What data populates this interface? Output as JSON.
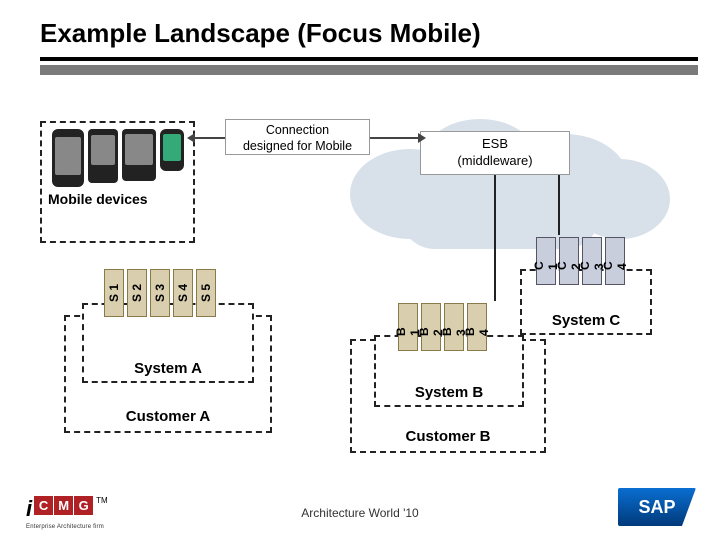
{
  "title": "Example Landscape (Focus Mobile)",
  "mobile_devices_label": "Mobile devices",
  "connection_label_line1": "Connection",
  "connection_label_line2": "designed for Mobile",
  "esb_line1": "ESB",
  "esb_line2": "(middleware)",
  "system_a": {
    "label": "System A",
    "services": [
      "S 1",
      "S 2",
      "S 3",
      "S 4",
      "S 5"
    ]
  },
  "customer_a_label": "Customer A",
  "system_b": {
    "label": "System B",
    "services": [
      "B 1",
      "B 2",
      "B 3",
      "B 4"
    ]
  },
  "customer_b_label": "Customer B",
  "system_c": {
    "label": "System C",
    "services": [
      "C 1",
      "C 2",
      "C 3",
      "C 4"
    ]
  },
  "footer_center": "Architecture World '10",
  "logo_left": {
    "letters": [
      "C",
      "M",
      "G"
    ],
    "tm": "TM",
    "sub": "Enterprise Architecture firm"
  },
  "logo_right": "SAP"
}
